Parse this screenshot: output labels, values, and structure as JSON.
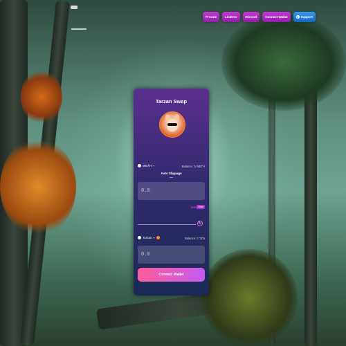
{
  "nav": {
    "presale": "Presale",
    "linktree": "Linktree",
    "discord": "Discord",
    "connect_wallet": "Connect Wallet",
    "support": "Support"
  },
  "swap": {
    "title": "Tarzan Swap",
    "from_token": "WETH",
    "from_balance": "Balance: 0 WETH",
    "auto_slippage": "Auto Slippage",
    "from_amount": "0.0",
    "percent": "50%",
    "max": "Max",
    "to_token": "Tarzan",
    "to_balance": "Balance: 0 TZN",
    "to_amount": "0.0",
    "connect_label": "Connect Wallet"
  },
  "colors": {
    "card_top": "#5b2f8f",
    "card_bottom": "#1a2a55",
    "nav_button": "#c43bd1",
    "support_button": "#1565c0",
    "connect_start": "#ff5c9a",
    "connect_end": "#c35cf0"
  },
  "icons": {
    "support": "discord-icon",
    "token": "coin-icon",
    "swap": "swap-arrows-icon"
  }
}
